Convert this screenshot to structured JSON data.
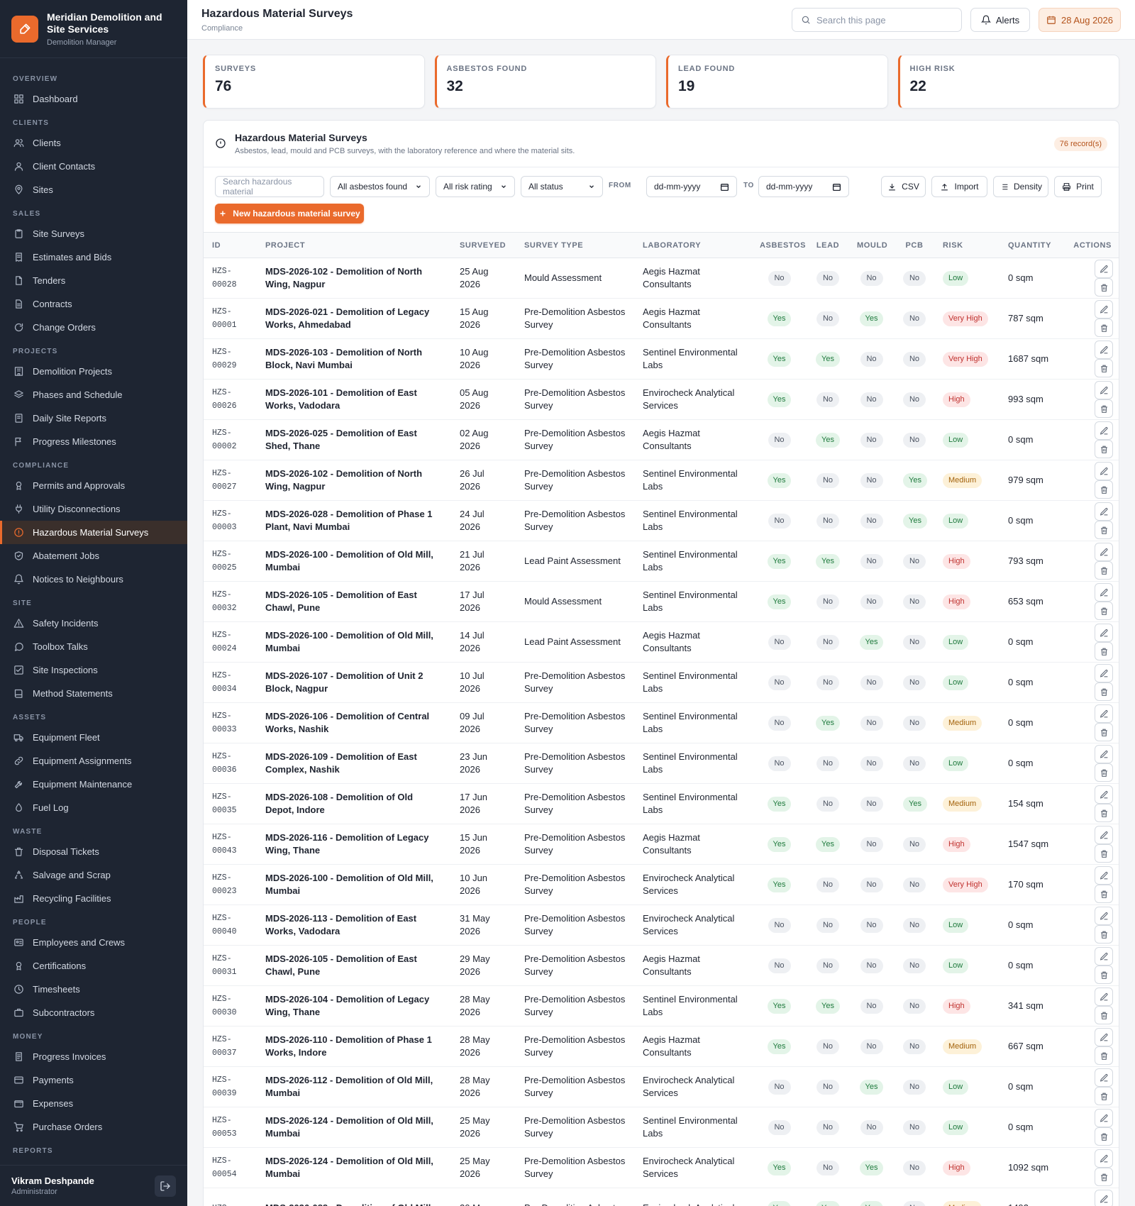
{
  "brand": {
    "name": "Meridian Demolition and Site Services",
    "sub": "Demolition Manager"
  },
  "nav": [
    {
      "section": "OVERVIEW",
      "items": [
        {
          "label": "Dashboard",
          "icon": "grid-icon"
        }
      ]
    },
    {
      "section": "CLIENTS",
      "items": [
        {
          "label": "Clients",
          "icon": "users-icon"
        },
        {
          "label": "Client Contacts",
          "icon": "user-icon"
        },
        {
          "label": "Sites",
          "icon": "pin-icon"
        }
      ]
    },
    {
      "section": "SALES",
      "items": [
        {
          "label": "Site Surveys",
          "icon": "clipboard-icon"
        },
        {
          "label": "Estimates and Bids",
          "icon": "receipt-icon"
        },
        {
          "label": "Tenders",
          "icon": "file-icon"
        },
        {
          "label": "Contracts",
          "icon": "doc-icon"
        },
        {
          "label": "Change Orders",
          "icon": "refresh-icon"
        }
      ]
    },
    {
      "section": "PROJECTS",
      "items": [
        {
          "label": "Demolition Projects",
          "icon": "building-icon"
        },
        {
          "label": "Phases and Schedule",
          "icon": "layers-icon"
        },
        {
          "label": "Daily Site Reports",
          "icon": "notebook-icon"
        },
        {
          "label": "Progress Milestones",
          "icon": "flag-icon"
        }
      ]
    },
    {
      "section": "COMPLIANCE",
      "items": [
        {
          "label": "Permits and Approvals",
          "icon": "award-icon"
        },
        {
          "label": "Utility Disconnections",
          "icon": "plug-icon"
        },
        {
          "label": "Hazardous Material Surveys",
          "icon": "alert-circle-icon",
          "active": true
        },
        {
          "label": "Abatement Jobs",
          "icon": "shield-icon"
        },
        {
          "label": "Notices to Neighbours",
          "icon": "bell-icon"
        }
      ]
    },
    {
      "section": "SITE",
      "items": [
        {
          "label": "Safety Incidents",
          "icon": "warning-icon"
        },
        {
          "label": "Toolbox Talks",
          "icon": "chat-icon"
        },
        {
          "label": "Site Inspections",
          "icon": "checklist-icon"
        },
        {
          "label": "Method Statements",
          "icon": "book-icon"
        }
      ]
    },
    {
      "section": "ASSETS",
      "items": [
        {
          "label": "Equipment Fleet",
          "icon": "truck-icon"
        },
        {
          "label": "Equipment Assignments",
          "icon": "link-icon"
        },
        {
          "label": "Equipment Maintenance",
          "icon": "wrench-icon"
        },
        {
          "label": "Fuel Log",
          "icon": "droplet-icon"
        }
      ]
    },
    {
      "section": "WASTE",
      "items": [
        {
          "label": "Disposal Tickets",
          "icon": "trash-icon"
        },
        {
          "label": "Salvage and Scrap",
          "icon": "recycle-icon"
        },
        {
          "label": "Recycling Facilities",
          "icon": "factory-icon"
        }
      ]
    },
    {
      "section": "PEOPLE",
      "items": [
        {
          "label": "Employees and Crews",
          "icon": "id-card-icon"
        },
        {
          "label": "Certifications",
          "icon": "award-icon"
        },
        {
          "label": "Timesheets",
          "icon": "clock-icon"
        },
        {
          "label": "Subcontractors",
          "icon": "briefcase-icon"
        }
      ]
    },
    {
      "section": "MONEY",
      "items": [
        {
          "label": "Progress Invoices",
          "icon": "invoice-icon"
        },
        {
          "label": "Payments",
          "icon": "card-icon"
        },
        {
          "label": "Expenses",
          "icon": "wallet-icon"
        },
        {
          "label": "Purchase Orders",
          "icon": "cart-icon"
        }
      ]
    },
    {
      "section": "REPORTS",
      "items": []
    }
  ],
  "user": {
    "name": "Vikram Deshpande",
    "role": "Administrator"
  },
  "topbar": {
    "title": "Hazardous Material Surveys",
    "crumb": "Compliance",
    "search_placeholder": "Search this page",
    "alerts": "Alerts",
    "date": "28 Aug 2026"
  },
  "stats": [
    {
      "label": "SURVEYS",
      "value": "76"
    },
    {
      "label": "ASBESTOS FOUND",
      "value": "32"
    },
    {
      "label": "LEAD FOUND",
      "value": "19"
    },
    {
      "label": "HIGH RISK",
      "value": "22"
    }
  ],
  "panel": {
    "title": "Hazardous Material Surveys",
    "subtitle": "Asbestos, lead, mould and PCB surveys, with the laboratory reference and where the material sits.",
    "count": "76 record(s)"
  },
  "filters": {
    "search_placeholder": "Search hazardous material",
    "asbestos": "All asbestos found",
    "risk": "All risk rating",
    "status": "All status",
    "from_label": "FROM",
    "to_label": "TO",
    "date_placeholder": "dd-mm-yyyy",
    "csv": "CSV",
    "import": "Import",
    "density": "Density",
    "print": "Print",
    "new_button": "New hazardous material survey"
  },
  "columns": [
    "ID",
    "PROJECT",
    "SURVEYED",
    "SURVEY TYPE",
    "LABORATORY",
    "ASBESTOS",
    "LEAD",
    "MOULD",
    "PCB",
    "RISK",
    "QUANTITY",
    "ACTIONS"
  ],
  "rows": [
    {
      "id": "HZS-00028",
      "project": "MDS-2026-102 - Demolition of North Wing, Nagpur",
      "surveyed": "25 Aug 2026",
      "type": "Mould Assessment",
      "lab": "Aegis Hazmat Consultants",
      "asbestos": "No",
      "lead": "No",
      "mould": "No",
      "pcb": "No",
      "risk": "Low",
      "qty": "0 sqm"
    },
    {
      "id": "HZS-00001",
      "project": "MDS-2026-021 - Demolition of Legacy Works, Ahmedabad",
      "surveyed": "15 Aug 2026",
      "type": "Pre-Demolition Asbestos Survey",
      "lab": "Aegis Hazmat Consultants",
      "asbestos": "Yes",
      "lead": "No",
      "mould": "Yes",
      "pcb": "No",
      "risk": "Very High",
      "qty": "787 sqm"
    },
    {
      "id": "HZS-00029",
      "project": "MDS-2026-103 - Demolition of North Block, Navi Mumbai",
      "surveyed": "10 Aug 2026",
      "type": "Pre-Demolition Asbestos Survey",
      "lab": "Sentinel Environmental Labs",
      "asbestos": "Yes",
      "lead": "Yes",
      "mould": "No",
      "pcb": "No",
      "risk": "Very High",
      "qty": "1687 sqm"
    },
    {
      "id": "HZS-00026",
      "project": "MDS-2026-101 - Demolition of East Works, Vadodara",
      "surveyed": "05 Aug 2026",
      "type": "Pre-Demolition Asbestos Survey",
      "lab": "Envirocheck Analytical Services",
      "asbestos": "Yes",
      "lead": "No",
      "mould": "No",
      "pcb": "No",
      "risk": "High",
      "qty": "993 sqm"
    },
    {
      "id": "HZS-00002",
      "project": "MDS-2026-025 - Demolition of East Shed, Thane",
      "surveyed": "02 Aug 2026",
      "type": "Pre-Demolition Asbestos Survey",
      "lab": "Aegis Hazmat Consultants",
      "asbestos": "No",
      "lead": "Yes",
      "mould": "No",
      "pcb": "No",
      "risk": "Low",
      "qty": "0 sqm"
    },
    {
      "id": "HZS-00027",
      "project": "MDS-2026-102 - Demolition of North Wing, Nagpur",
      "surveyed": "26 Jul 2026",
      "type": "Pre-Demolition Asbestos Survey",
      "lab": "Sentinel Environmental Labs",
      "asbestos": "Yes",
      "lead": "No",
      "mould": "No",
      "pcb": "Yes",
      "risk": "Medium",
      "qty": "979 sqm"
    },
    {
      "id": "HZS-00003",
      "project": "MDS-2026-028 - Demolition of Phase 1 Plant, Navi Mumbai",
      "surveyed": "24 Jul 2026",
      "type": "Pre-Demolition Asbestos Survey",
      "lab": "Sentinel Environmental Labs",
      "asbestos": "No",
      "lead": "No",
      "mould": "No",
      "pcb": "Yes",
      "risk": "Low",
      "qty": "0 sqm"
    },
    {
      "id": "HZS-00025",
      "project": "MDS-2026-100 - Demolition of Old Mill, Mumbai",
      "surveyed": "21 Jul 2026",
      "type": "Lead Paint Assessment",
      "lab": "Sentinel Environmental Labs",
      "asbestos": "Yes",
      "lead": "Yes",
      "mould": "No",
      "pcb": "No",
      "risk": "High",
      "qty": "793 sqm"
    },
    {
      "id": "HZS-00032",
      "project": "MDS-2026-105 - Demolition of East Chawl, Pune",
      "surveyed": "17 Jul 2026",
      "type": "Mould Assessment",
      "lab": "Sentinel Environmental Labs",
      "asbestos": "Yes",
      "lead": "No",
      "mould": "No",
      "pcb": "No",
      "risk": "High",
      "qty": "653 sqm"
    },
    {
      "id": "HZS-00024",
      "project": "MDS-2026-100 - Demolition of Old Mill, Mumbai",
      "surveyed": "14 Jul 2026",
      "type": "Lead Paint Assessment",
      "lab": "Aegis Hazmat Consultants",
      "asbestos": "No",
      "lead": "No",
      "mould": "Yes",
      "pcb": "No",
      "risk": "Low",
      "qty": "0 sqm"
    },
    {
      "id": "HZS-00034",
      "project": "MDS-2026-107 - Demolition of Unit 2 Block, Nagpur",
      "surveyed": "10 Jul 2026",
      "type": "Pre-Demolition Asbestos Survey",
      "lab": "Sentinel Environmental Labs",
      "asbestos": "No",
      "lead": "No",
      "mould": "No",
      "pcb": "No",
      "risk": "Low",
      "qty": "0 sqm"
    },
    {
      "id": "HZS-00033",
      "project": "MDS-2026-106 - Demolition of Central Works, Nashik",
      "surveyed": "09 Jul 2026",
      "type": "Pre-Demolition Asbestos Survey",
      "lab": "Sentinel Environmental Labs",
      "asbestos": "No",
      "lead": "Yes",
      "mould": "No",
      "pcb": "No",
      "risk": "Medium",
      "qty": "0 sqm"
    },
    {
      "id": "HZS-00036",
      "project": "MDS-2026-109 - Demolition of East Complex, Nashik",
      "surveyed": "23 Jun 2026",
      "type": "Pre-Demolition Asbestos Survey",
      "lab": "Sentinel Environmental Labs",
      "asbestos": "No",
      "lead": "No",
      "mould": "No",
      "pcb": "No",
      "risk": "Low",
      "qty": "0 sqm"
    },
    {
      "id": "HZS-00035",
      "project": "MDS-2026-108 - Demolition of Old Depot, Indore",
      "surveyed": "17 Jun 2026",
      "type": "Pre-Demolition Asbestos Survey",
      "lab": "Sentinel Environmental Labs",
      "asbestos": "Yes",
      "lead": "No",
      "mould": "No",
      "pcb": "Yes",
      "risk": "Medium",
      "qty": "154 sqm"
    },
    {
      "id": "HZS-00043",
      "project": "MDS-2026-116 - Demolition of Legacy Wing, Thane",
      "surveyed": "15 Jun 2026",
      "type": "Pre-Demolition Asbestos Survey",
      "lab": "Aegis Hazmat Consultants",
      "asbestos": "Yes",
      "lead": "Yes",
      "mould": "No",
      "pcb": "No",
      "risk": "High",
      "qty": "1547 sqm"
    },
    {
      "id": "HZS-00023",
      "project": "MDS-2026-100 - Demolition of Old Mill, Mumbai",
      "surveyed": "10 Jun 2026",
      "type": "Pre-Demolition Asbestos Survey",
      "lab": "Envirocheck Analytical Services",
      "asbestos": "Yes",
      "lead": "No",
      "mould": "No",
      "pcb": "No",
      "risk": "Very High",
      "qty": "170 sqm"
    },
    {
      "id": "HZS-00040",
      "project": "MDS-2026-113 - Demolition of East Works, Vadodara",
      "surveyed": "31 May 2026",
      "type": "Pre-Demolition Asbestos Survey",
      "lab": "Envirocheck Analytical Services",
      "asbestos": "No",
      "lead": "No",
      "mould": "No",
      "pcb": "No",
      "risk": "Low",
      "qty": "0 sqm"
    },
    {
      "id": "HZS-00031",
      "project": "MDS-2026-105 - Demolition of East Chawl, Pune",
      "surveyed": "29 May 2026",
      "type": "Pre-Demolition Asbestos Survey",
      "lab": "Aegis Hazmat Consultants",
      "asbestos": "No",
      "lead": "No",
      "mould": "No",
      "pcb": "No",
      "risk": "Low",
      "qty": "0 sqm"
    },
    {
      "id": "HZS-00030",
      "project": "MDS-2026-104 - Demolition of Legacy Wing, Thane",
      "surveyed": "28 May 2026",
      "type": "Pre-Demolition Asbestos Survey",
      "lab": "Sentinel Environmental Labs",
      "asbestos": "Yes",
      "lead": "Yes",
      "mould": "No",
      "pcb": "No",
      "risk": "High",
      "qty": "341 sqm"
    },
    {
      "id": "HZS-00037",
      "project": "MDS-2026-110 - Demolition of Phase 1 Works, Indore",
      "surveyed": "28 May 2026",
      "type": "Pre-Demolition Asbestos Survey",
      "lab": "Aegis Hazmat Consultants",
      "asbestos": "Yes",
      "lead": "No",
      "mould": "No",
      "pcb": "No",
      "risk": "Medium",
      "qty": "667 sqm"
    },
    {
      "id": "HZS-00039",
      "project": "MDS-2026-112 - Demolition of Old Mill, Mumbai",
      "surveyed": "28 May 2026",
      "type": "Pre-Demolition Asbestos Survey",
      "lab": "Envirocheck Analytical Services",
      "asbestos": "No",
      "lead": "No",
      "mould": "Yes",
      "pcb": "No",
      "risk": "Low",
      "qty": "0 sqm"
    },
    {
      "id": "HZS-00053",
      "project": "MDS-2026-124 - Demolition of Old Mill, Mumbai",
      "surveyed": "25 May 2026",
      "type": "Pre-Demolition Asbestos Survey",
      "lab": "Sentinel Environmental Labs",
      "asbestos": "No",
      "lead": "No",
      "mould": "No",
      "pcb": "No",
      "risk": "Low",
      "qty": "0 sqm"
    },
    {
      "id": "HZS-00054",
      "project": "MDS-2026-124 - Demolition of Old Mill, Mumbai",
      "surveyed": "25 May 2026",
      "type": "Pre-Demolition Asbestos Survey",
      "lab": "Envirocheck Analytical Services",
      "asbestos": "Yes",
      "lead": "No",
      "mould": "Yes",
      "pcb": "No",
      "risk": "High",
      "qty": "1092 sqm"
    },
    {
      "id": "HZS-",
      "project": "MDS-2026-088 - Demolition of Old Mill,",
      "surveyed": "20 May",
      "type": "Pre-Demolition Asbestos",
      "lab": "Envirocheck Analytical",
      "asbestos": "Yes",
      "lead": "Yes",
      "mould": "Yes",
      "pcb": "No",
      "risk": "Medium",
      "qty": "1492 sqm"
    }
  ]
}
